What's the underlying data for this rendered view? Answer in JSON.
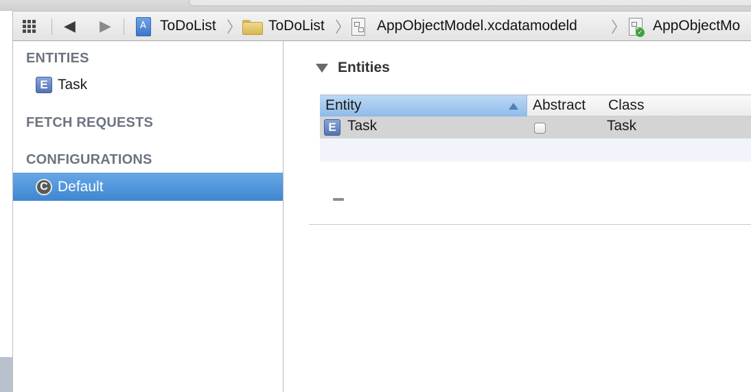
{
  "jumpbar": {
    "breadcrumbs": [
      {
        "label": "ToDoList",
        "icon": "project-icon"
      },
      {
        "label": "ToDoList",
        "icon": "folder-icon"
      },
      {
        "label": "AppObjectModel.xcdatamodeld",
        "icon": "data-model-icon"
      },
      {
        "label": "AppObjectMo",
        "icon": "data-model-version-icon"
      }
    ],
    "chevron": "〉",
    "back_glyph": "◀",
    "forward_glyph": "▶"
  },
  "sidebar": {
    "entities_heading": "ENTITIES",
    "entities": [
      {
        "badge": "E",
        "label": "Task"
      }
    ],
    "fetch_requests_heading": "FETCH REQUESTS",
    "configurations_heading": "CONFIGURATIONS",
    "configurations": [
      {
        "badge": "C",
        "label": "Default",
        "selected": true
      }
    ]
  },
  "main": {
    "section_title": "Entities",
    "table": {
      "columns": [
        "Entity",
        "Abstract",
        "Class"
      ],
      "rows": [
        {
          "badge": "E",
          "entity": "Task",
          "abstract": false,
          "class": "Task"
        }
      ]
    }
  },
  "colors": {
    "selection": "#4a90d9",
    "heading_gray": "#6c7480",
    "entity_badge": "#5b7bbf"
  }
}
